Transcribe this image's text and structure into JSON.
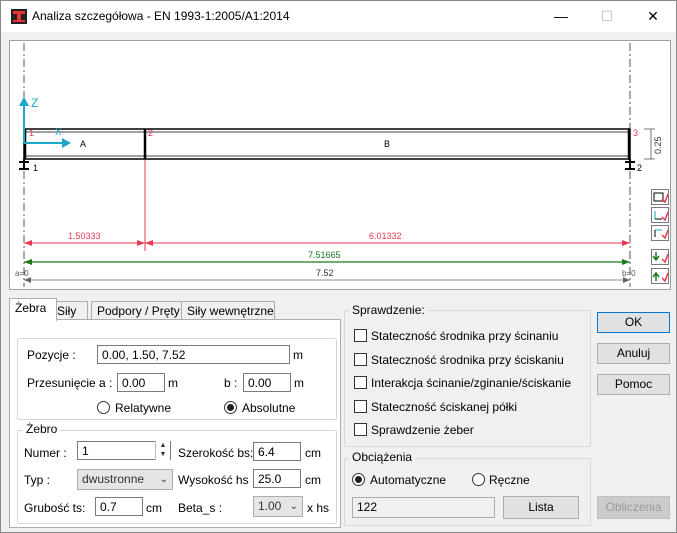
{
  "window": {
    "title": "Analiza szczegółowa - EN 1993-1:2005/A1:2014",
    "minimize_icon": "minimize-icon",
    "maximize_icon": "maximize-icon",
    "close_icon": "close-icon"
  },
  "drawing": {
    "axis_z": "Z",
    "axis_x": "X",
    "segment_a": "A",
    "segment_b": "B",
    "node_1": "1",
    "node_2": "2",
    "node_3": "3",
    "node_bottom_1": "1",
    "node_bottom_2": "2",
    "height_dim": "0.25",
    "dim_a": "1.50333",
    "dim_b": "6.01332",
    "dim_total_green": "7.51665",
    "dim_total": "7.52",
    "a0": "a=0",
    "b0": "b=0",
    "colors": {
      "red": "#e8384f",
      "green": "#1a7a1a",
      "cyan": "#1aa7c8"
    }
  },
  "tabs": [
    "Żebra",
    "Siły",
    "Podpory / Pręty",
    "Siły wewnętrzne"
  ],
  "zebra_tab": {
    "pozycje_label": "Pozycje :",
    "pozycje_value": "0.00, 1.50, 7.52",
    "pozycje_unit": "m",
    "przesuniecie_label": "Przesunięcie :",
    "a_label": "a :",
    "a_value": "0.00",
    "a_unit": "m",
    "b_label": "b :",
    "b_value": "0.00",
    "b_unit": "m",
    "relatywne": "Relatywne",
    "absolutne": "Absolutne",
    "group_title": "Żebro",
    "numer_label": "Numer :",
    "numer_value": "1",
    "typ_label": "Typ :",
    "typ_value": "dwustronne",
    "grubosc_label": "Grubość ts:",
    "grubosc_value": "0.7",
    "grubosc_unit": "cm",
    "szer_label": "Szerokość bs:",
    "szer_value": "6.4",
    "szer_unit": "cm",
    "wys_label": "Wysokość hs :",
    "wys_value": "25.0",
    "wys_unit": "cm",
    "beta_label": "Beta_s :",
    "beta_value": "1.00",
    "beta_unit": "x  hs"
  },
  "sprawdzenie": {
    "title": "Sprawdzenie:",
    "items": [
      "Stateczność środnika przy ścinaniu",
      "Stateczność środnika przy ściskaniu",
      "Interakcja ścinanie/zginanie/ściskanie",
      "Stateczność ściskanej półki",
      "Sprawdzenie żeber"
    ]
  },
  "obciazenia": {
    "title": "Obciążenia",
    "automatyczne": "Automatyczne",
    "reczne": "Ręczne",
    "value": "122",
    "lista": "Lista"
  },
  "buttons": {
    "ok": "OK",
    "anuluj": "Anuluj",
    "pomoc": "Pomoc",
    "obliczenia": "Obliczenia"
  }
}
